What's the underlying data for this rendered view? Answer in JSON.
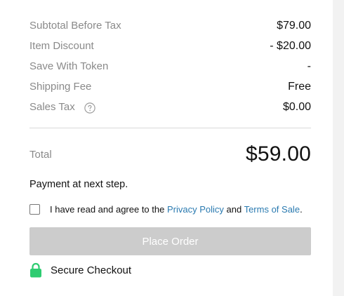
{
  "summary": {
    "rows": [
      {
        "label": "Subtotal Before Tax",
        "value": "$79.00"
      },
      {
        "label": "Item Discount",
        "value": "- $20.00"
      },
      {
        "label": "Save With Token",
        "value": "-"
      },
      {
        "label": "Shipping Fee",
        "value": "Free"
      },
      {
        "label": "Sales Tax",
        "value": "$0.00"
      }
    ],
    "help_icon": "question-circle-icon"
  },
  "total": {
    "label": "Total",
    "value": "$59.00"
  },
  "payment_note": "Payment at next step.",
  "agreement": {
    "prefix": "I have read and agree to the ",
    "privacy_link": "Privacy Policy",
    "middle": " and ",
    "terms_link": "Terms of Sale",
    "suffix": ".",
    "checked": false,
    "link_color": "#2a7ab0"
  },
  "place_order": {
    "label": "Place Order",
    "disabled": true,
    "background": "#cccccc"
  },
  "secure": {
    "label": "Secure Checkout",
    "icon": "lock-icon",
    "icon_color": "#2ecc71"
  }
}
